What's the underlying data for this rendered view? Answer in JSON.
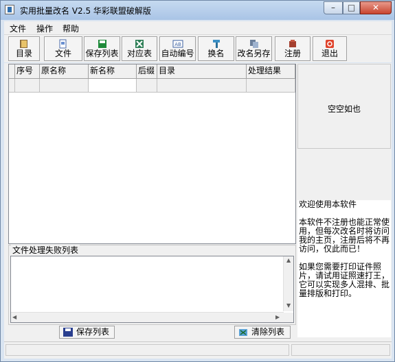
{
  "window": {
    "title": "实用批量改名 V2.5 华彩联盟破解版",
    "minimize_glyph": "–",
    "maximize_glyph": "□",
    "close_glyph": "✕"
  },
  "menu": [
    "文件",
    "操作",
    "帮助"
  ],
  "toolbar": [
    {
      "label": "目录",
      "icon": "folder-book-icon"
    },
    {
      "label": "文件",
      "icon": "file-icon"
    },
    {
      "label": "保存列表",
      "icon": "save-icon"
    },
    {
      "label": "对应表",
      "icon": "excel-icon"
    },
    {
      "label": "自动编号",
      "icon": "ab-icon"
    },
    {
      "label": "换名",
      "icon": "rename-icon"
    },
    {
      "label": "改名另存",
      "icon": "copy-icon"
    },
    {
      "label": "注册",
      "icon": "register-icon"
    },
    {
      "label": "退出",
      "icon": "exit-icon"
    }
  ],
  "grid": {
    "columns": [
      "序号",
      "原名称",
      "新名称",
      "后缀",
      "目录",
      "处理结果"
    ]
  },
  "right_panel": {
    "empty_text": "空空如也",
    "welcome_lines": [
      "欢迎使用本软件",
      "本软件不注册也能正常使用，但每次改名时将访问我的主页，注册后将不再访问，仅此而已！",
      "如果您需要打印证件照片，请试用证照速打王，它可以实现多人混排、批量排版和打印。"
    ]
  },
  "fail_list": {
    "label": "文件处理失败列表"
  },
  "bottom_buttons": {
    "save_label": "保存列表",
    "clear_label": "清除列表"
  },
  "colors": {
    "accent": "#2e6fb0",
    "close_red": "#c9442f"
  }
}
